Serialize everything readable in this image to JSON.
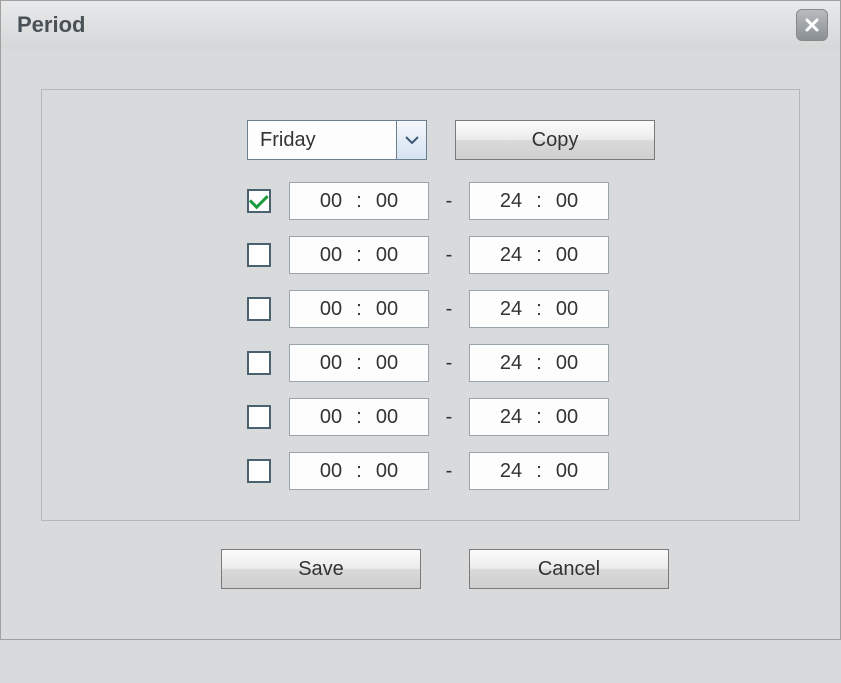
{
  "dialog": {
    "title": "Period"
  },
  "header": {
    "day_selected": "Friday",
    "copy_label": "Copy"
  },
  "periods": [
    {
      "enabled": true,
      "start_h": "00",
      "start_m": "00",
      "end_h": "24",
      "end_m": "00"
    },
    {
      "enabled": false,
      "start_h": "00",
      "start_m": "00",
      "end_h": "24",
      "end_m": "00"
    },
    {
      "enabled": false,
      "start_h": "00",
      "start_m": "00",
      "end_h": "24",
      "end_m": "00"
    },
    {
      "enabled": false,
      "start_h": "00",
      "start_m": "00",
      "end_h": "24",
      "end_m": "00"
    },
    {
      "enabled": false,
      "start_h": "00",
      "start_m": "00",
      "end_h": "24",
      "end_m": "00"
    },
    {
      "enabled": false,
      "start_h": "00",
      "start_m": "00",
      "end_h": "24",
      "end_m": "00"
    }
  ],
  "footer": {
    "save_label": "Save",
    "cancel_label": "Cancel"
  },
  "separators": {
    "colon": ":",
    "dash": "-"
  }
}
